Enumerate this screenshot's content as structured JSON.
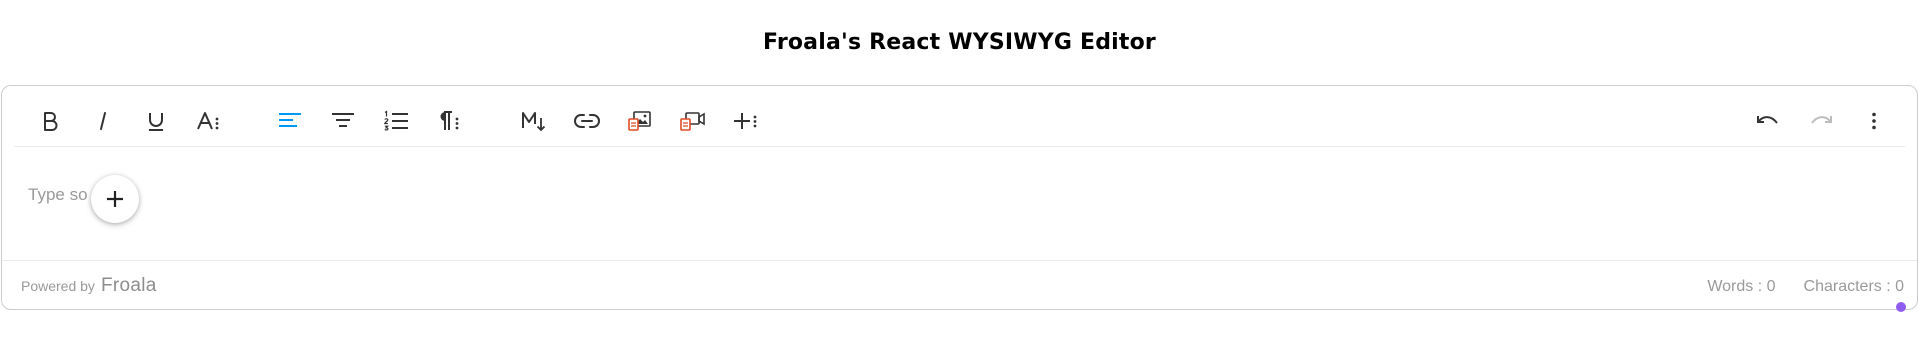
{
  "page": {
    "title": "Froala's React WYSIWYG Editor"
  },
  "toolbar": {
    "buttons": [
      {
        "name": "bold",
        "icon": "bold-icon"
      },
      {
        "name": "italic",
        "icon": "italic-icon"
      },
      {
        "name": "underline",
        "icon": "underline-icon"
      },
      {
        "name": "more-text",
        "icon": "text-format-more-icon"
      },
      {
        "name": "align-left",
        "icon": "align-left-icon",
        "active": true
      },
      {
        "name": "align-center",
        "icon": "align-center-icon"
      },
      {
        "name": "ordered-list",
        "icon": "ordered-list-icon"
      },
      {
        "name": "more-paragraph",
        "icon": "paragraph-more-icon"
      },
      {
        "name": "markdown",
        "icon": "markdown-icon"
      },
      {
        "name": "insert-link",
        "icon": "link-icon"
      },
      {
        "name": "insert-image",
        "icon": "image-icon"
      },
      {
        "name": "insert-video",
        "icon": "video-icon"
      },
      {
        "name": "more-rich",
        "icon": "insert-more-icon"
      },
      {
        "name": "undo",
        "icon": "undo-icon"
      },
      {
        "name": "redo",
        "icon": "redo-icon",
        "disabled": true
      },
      {
        "name": "more-misc",
        "icon": "more-vertical-icon"
      }
    ]
  },
  "editor": {
    "placeholder": "Type something",
    "placeholder_visible_left": "Type so",
    "placeholder_visible_right": "g",
    "quick_insert_icon": "plus-icon"
  },
  "footer": {
    "powered_by": "Powered by",
    "brand": "Froala",
    "words_label": "Words : 0",
    "characters_label": "Characters : 0"
  },
  "colors": {
    "accent_blue": "#0098f7",
    "image_red": "#e04b22",
    "indicator_purple": "#8f5cf0",
    "icon_dark": "#333333",
    "icon_disabled": "#bdbdbd"
  }
}
